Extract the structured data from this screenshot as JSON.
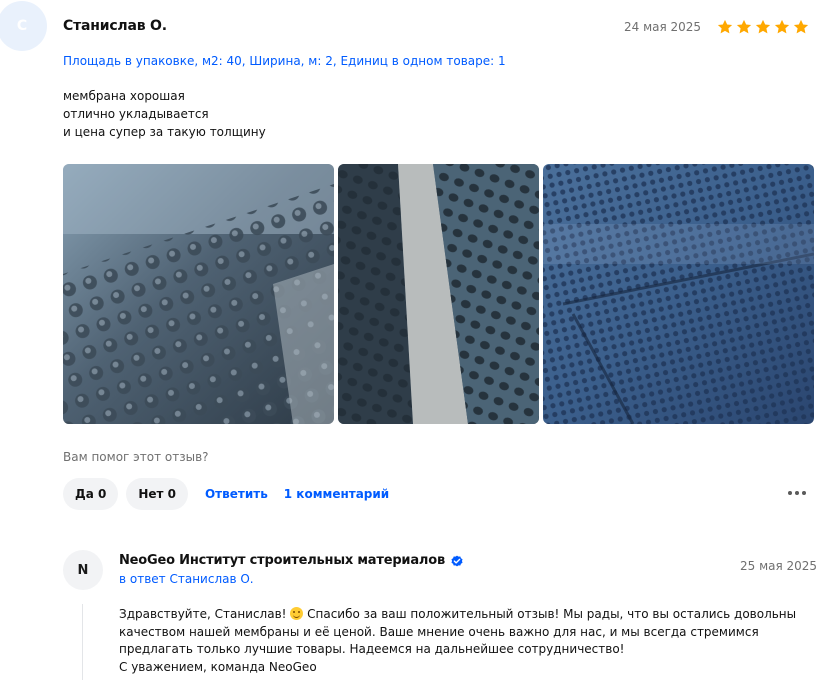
{
  "review": {
    "avatar_letter": "С",
    "author": "Станислав О.",
    "date": "24 мая 2025",
    "rating": 5,
    "variant": "Площадь в упаковке, м2: 40, Ширина, м: 2, Единиц в одном товаре: 1",
    "text_lines": [
      "мембрана хорошая",
      "отлично укладывается",
      "и цена супер за такую толщину"
    ],
    "photos": [
      {
        "icon": "photo-membrane-closeup"
      },
      {
        "icon": "photo-membrane-rolled"
      },
      {
        "icon": "photo-membrane-laid"
      }
    ],
    "helpful_question": "Вам помог этот отзыв?",
    "yes_label": "Да 0",
    "no_label": "Нет 0",
    "reply_link": "Ответить",
    "comments_link": "1 комментарий"
  },
  "seller_reply": {
    "avatar_letter": "N",
    "name": "NeoGeo Институт строительных материалов",
    "reply_to": "в ответ Станислав О.",
    "date": "25 мая 2025",
    "text_line1_a": "Здравствуйте, Станислав!",
    "text_line1_b": "Спасибо за ваш положительный отзыв! Мы рады, что вы остались довольны",
    "text_lines": [
      "качеством нашей мембраны и её ценой. Ваше мнение очень важно для нас, и мы всегда стремимся",
      "предлагать только лучшие товары. Надеемся на дальнейшее сотрудничество!",
      "С уважением, команда NeoGeo"
    ]
  },
  "colors": {
    "accent": "#005bff",
    "star": "#ffa800",
    "muted": "#707070",
    "pill": "#f2f3f5"
  }
}
